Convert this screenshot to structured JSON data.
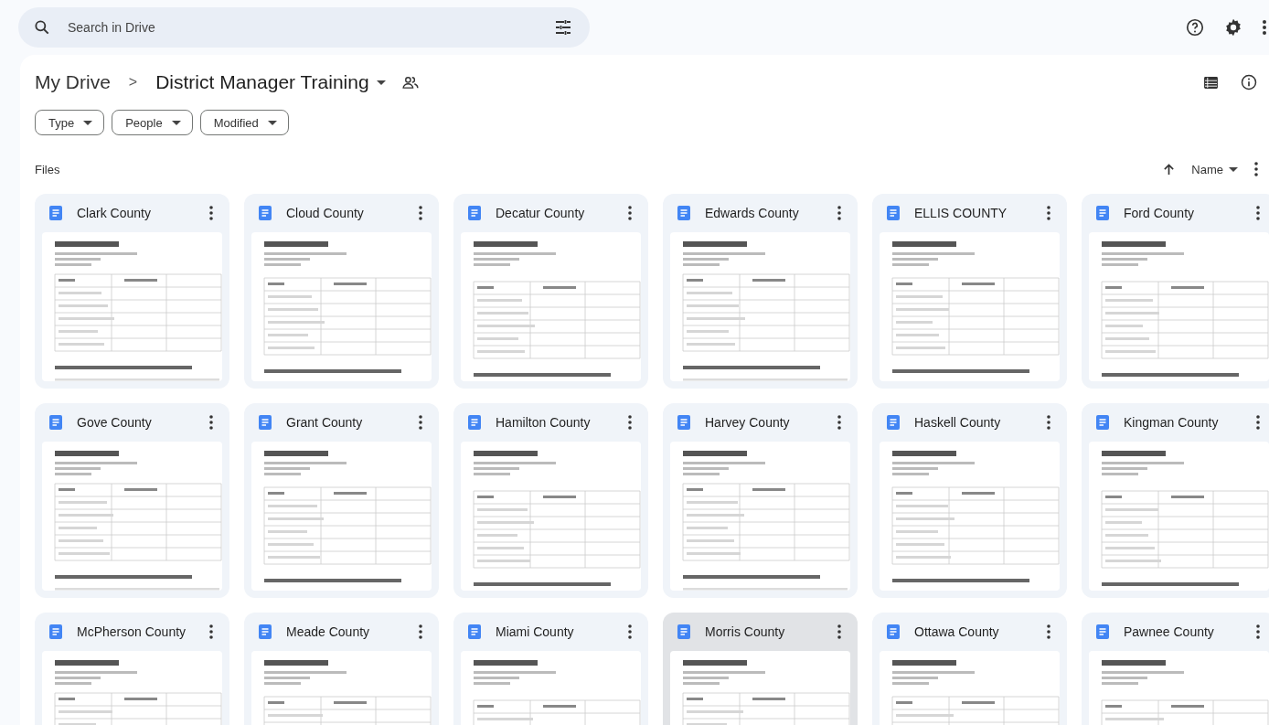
{
  "search": {
    "placeholder": "Search in Drive"
  },
  "breadcrumb": {
    "root": "My Drive",
    "separator": ">",
    "folder": "District Manager Training"
  },
  "filters": [
    {
      "label": "Type"
    },
    {
      "label": "People"
    },
    {
      "label": "Modified"
    }
  ],
  "section": {
    "title": "Files",
    "sort_label": "Name"
  },
  "files": [
    {
      "name": "Clark County",
      "selected": false
    },
    {
      "name": "Cloud County",
      "selected": false
    },
    {
      "name": "Decatur County",
      "selected": false
    },
    {
      "name": "Edwards County",
      "selected": false
    },
    {
      "name": "ELLIS COUNTY",
      "selected": false
    },
    {
      "name": "Ford County",
      "selected": false
    },
    {
      "name": "Gove County",
      "selected": false
    },
    {
      "name": "Grant County",
      "selected": false
    },
    {
      "name": "Hamilton County",
      "selected": false
    },
    {
      "name": "Harvey County",
      "selected": false
    },
    {
      "name": "Haskell County",
      "selected": false
    },
    {
      "name": "Kingman County",
      "selected": false
    },
    {
      "name": "McPherson County",
      "selected": false
    },
    {
      "name": "Meade County",
      "selected": false
    },
    {
      "name": "Miami County",
      "selected": false
    },
    {
      "name": "Morris County",
      "selected": true
    },
    {
      "name": "Ottawa County",
      "selected": false
    },
    {
      "name": "Pawnee County",
      "selected": false
    }
  ]
}
